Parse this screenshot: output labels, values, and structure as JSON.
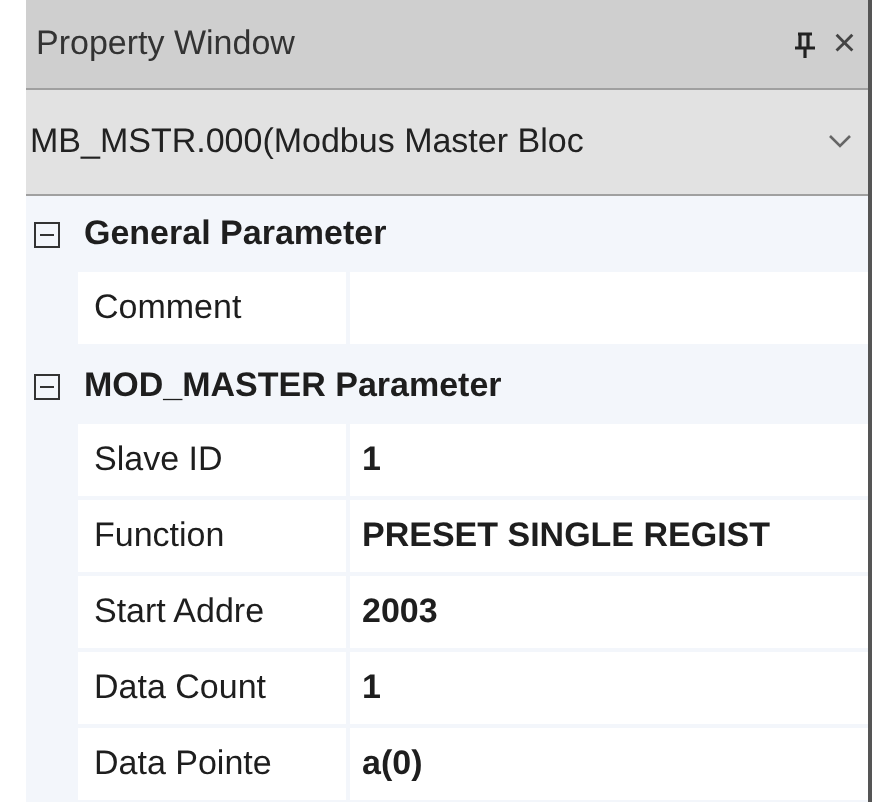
{
  "window": {
    "title": "Property Window",
    "close": "×"
  },
  "object_selector": {
    "value": "MB_MSTR.000(Modbus Master Bloc"
  },
  "categories": [
    {
      "label": "General Parameter",
      "expanded": true,
      "properties": [
        {
          "name": "Comment"
        }
      ]
    },
    {
      "label": "MOD_MASTER Parameter",
      "expanded": true,
      "properties": [
        {
          "name": "Slave ID",
          "value": "1"
        },
        {
          "name": "Function",
          "value": "PRESET SINGLE REGIST"
        },
        {
          "name": "Start Addre",
          "value": "2003"
        },
        {
          "name": "Data Count",
          "value": "1"
        },
        {
          "name": "Data Pointe",
          "value": "a(0)"
        }
      ]
    }
  ]
}
